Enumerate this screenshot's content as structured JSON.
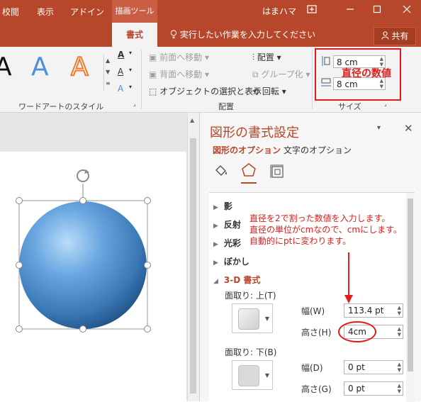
{
  "titlebar": {
    "context_tools": "描画ツール",
    "user": "はまハマ",
    "colors": {
      "brand": "#b7472a",
      "annotation": "#e31b1b",
      "accent_text": "#b7472a"
    }
  },
  "tabs": [
    "校閲",
    "表示",
    "アドイン",
    "書式"
  ],
  "tell_me": "実行したい作業を入力してください",
  "share": "共有",
  "ribbon": {
    "wordart": {
      "glyph": "A",
      "group_label": "ワードアートのスタイル"
    },
    "text_fill_label": "A",
    "arrange": {
      "bring_forward": "前面へ移動",
      "send_backward": "背面へ移動",
      "selection_pane": "オブジェクトの選択と表示",
      "align": "配置",
      "group": "グループ化",
      "rotate": "回転",
      "group_label": "配置"
    },
    "size": {
      "height": "8 cm",
      "width": "8 cm",
      "group_label": "サイズ",
      "note": "直径の数値"
    }
  },
  "pane": {
    "title": "図形の書式設定",
    "tab_shape": "図形のオプション",
    "tab_text": "文字のオプション",
    "sections": {
      "shadow": "影",
      "reflection": "反射",
      "glow": "光彩",
      "soft_edges": "ぼかし",
      "three_d": "3-D 書式"
    },
    "bevel_top": "面取り: 上(T)",
    "bevel_bottom": "面取り: 下(B)",
    "top_width_label": "幅(W)",
    "top_width_value": "113.4 pt",
    "top_height_label": "高さ(H)",
    "top_height_value": "4cm",
    "bottom_width_label": "幅(D)",
    "bottom_width_value": "0 pt",
    "bottom_height_label": "高さ(G)",
    "bottom_height_value": "0 pt",
    "note_lines": [
      "直径を2で割った数値を入力します。",
      "直径の単位がcmなので、cmにします。",
      "自動的にptに変わります。"
    ]
  },
  "icons": [
    "restore-icon",
    "minimize-icon",
    "maximize-icon",
    "close-icon",
    "lightbulb-icon",
    "person-icon",
    "rotate-handle-icon",
    "fill-line-icon",
    "effects-icon",
    "size-properties-icon"
  ]
}
